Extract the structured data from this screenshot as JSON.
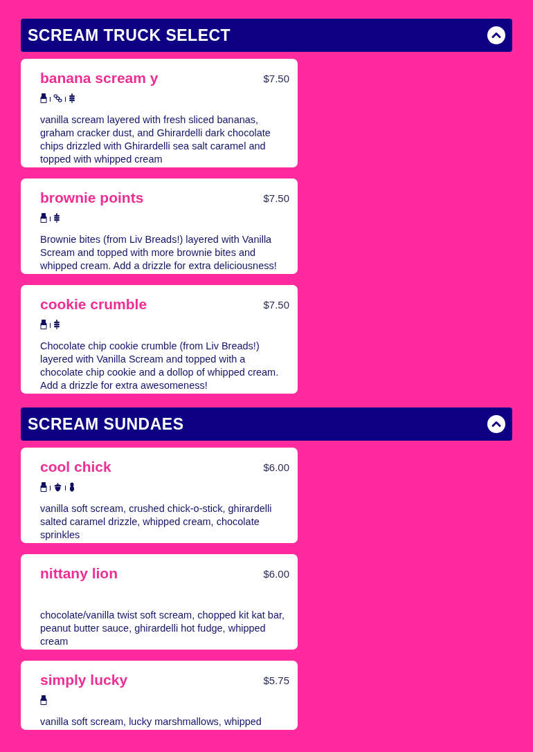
{
  "sections": [
    {
      "title": "SCREAM TRUCK SELECT",
      "expanded": true,
      "items": [
        {
          "name": "banana scream y",
          "price": "$7.50",
          "icons": [
            {
              "kind": "dairy"
            },
            {
              "kind": "links"
            },
            {
              "kind": "gluten"
            }
          ],
          "description": "vanilla scream layered with fresh sliced bananas, graham cracker dust, and Ghirardelli dark chocolate chips drizzled with Ghirardelli sea salt caramel and topped with whipped cream"
        },
        {
          "name": "brownie points",
          "price": "$7.50",
          "icons": [
            {
              "kind": "dairy"
            },
            {
              "kind": "gluten"
            }
          ],
          "description": "Brownie bites (from Liv Breads!) layered with Vanilla Scream and topped with more brownie bites and whipped cream. Add a drizzle for extra deliciousness!"
        },
        {
          "name": "cookie crumble",
          "price": "$7.50",
          "icons": [
            {
              "kind": "dairy"
            },
            {
              "kind": "gluten"
            }
          ],
          "description": "Chocolate chip cookie crumble (from Liv Breads!) layered with Vanilla Scream and topped with a chocolate chip cookie and a dollop of whipped cream. Add a drizzle for extra awesomeness!"
        }
      ]
    },
    {
      "title": "SCREAM SUNDAES",
      "expanded": true,
      "items": [
        {
          "name": "cool chick",
          "price": "$6.00",
          "icons": [
            {
              "kind": "dairy"
            },
            {
              "kind": "nut"
            },
            {
              "kind": "peanut"
            }
          ],
          "description": "vanilla soft scream, crushed chick-o-stick, ghirardelli salted caramel drizzle, whipped cream, chocolate sprinkles"
        },
        {
          "name": "nittany lion",
          "price": "$6.00",
          "description": "chocolate/vanilla twist soft scream, chopped kit kat bar, peanut butter sauce, ghirardelli hot fudge, whipped cream"
        },
        {
          "name": "simply lucky",
          "price": "$5.75",
          "icons": [
            {
              "kind": "dairy"
            }
          ],
          "description": "vanilla soft scream, lucky marshmallows, whipped"
        }
      ]
    }
  ]
}
